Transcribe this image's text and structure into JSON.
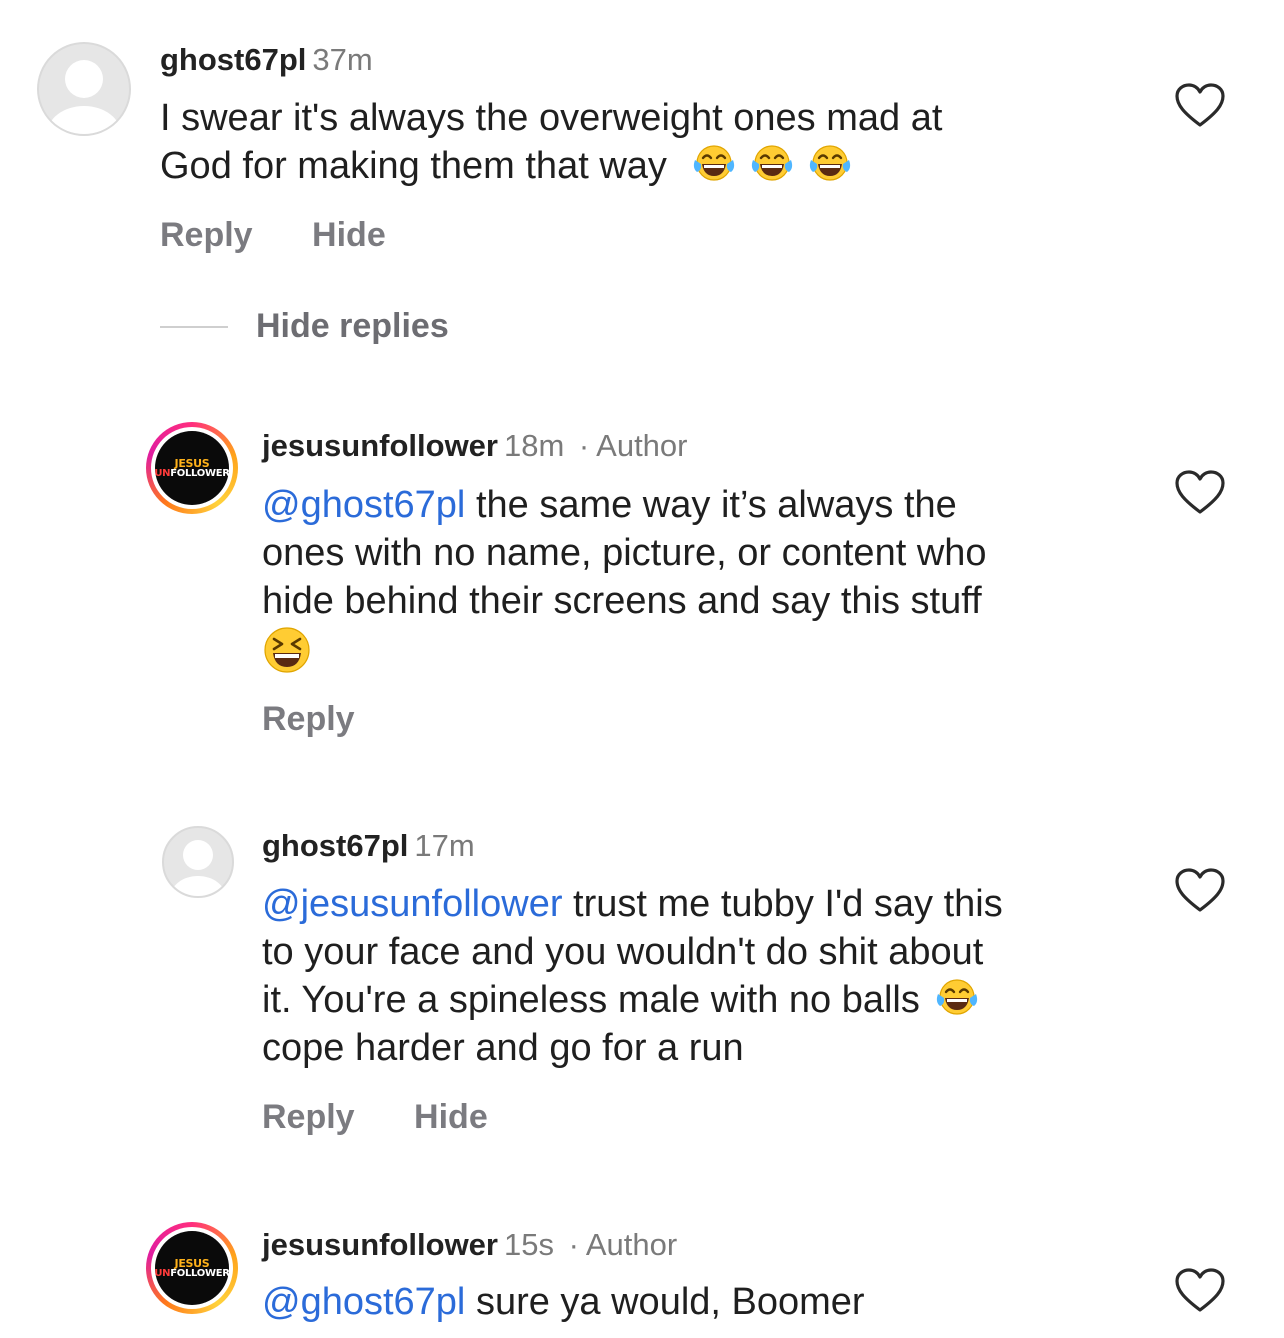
{
  "comments": [
    {
      "username": "ghost67pl",
      "time": "37m",
      "author_tag": "",
      "line1": "I swear it's always the overweight ones mad at",
      "line2": "God for making them that way",
      "emoji_count": 3,
      "reply_label": "Reply",
      "hide_label": "Hide"
    },
    {
      "username": "jesusunfollower",
      "time": "18m",
      "author_tag": "· Author",
      "mention": "@ghost67pl",
      "line1": " the same way it’s always the",
      "line2": "ones with no name, picture, or content who",
      "line3": "hide behind their screens and say this stuff",
      "reply_label": "Reply"
    },
    {
      "username": "ghost67pl",
      "time": "17m",
      "mention": "@jesusunfollower",
      "line1": " trust me tubby I'd say this",
      "line2": "to your face and you wouldn't do shit about",
      "line3": "it. You're a spineless male with no balls",
      "line4": "cope harder and go for a run",
      "reply_label": "Reply",
      "hide_label": "Hide"
    },
    {
      "username": "jesusunfollower",
      "time": "15s",
      "author_tag": "· Author",
      "mention": "@ghost67pl",
      "line1": " sure ya would, Boomer"
    }
  ],
  "thread": {
    "hide_replies_label": "Hide replies"
  },
  "brand_avatar": {
    "line1": "JESUS",
    "line2_prefix": "UN",
    "line2_rest": "FOLLOWER"
  },
  "colors": {
    "mention": "#2b6bd9",
    "secondary": "#7b7b80",
    "background": "#ffffff"
  },
  "icons": {
    "like": "heart-outline-icon",
    "laugh": "tears-of-joy-emoji",
    "grin": "grinning-squinting-emoji"
  }
}
